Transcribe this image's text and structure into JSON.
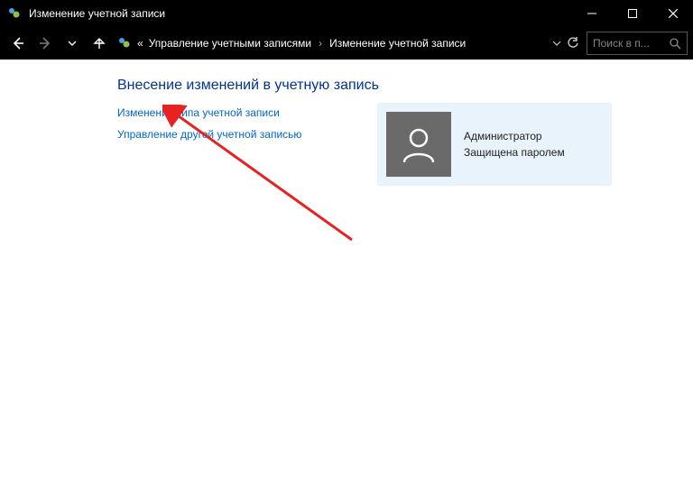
{
  "window": {
    "title": "Изменение учетной записи"
  },
  "breadcrumb": {
    "root_symbol": "«",
    "item1": "Управление учетными записями",
    "item2": "Изменение учетной записи"
  },
  "search": {
    "placeholder": "Поиск в п..."
  },
  "page": {
    "heading": "Внесение изменений в учетную запись",
    "link_change_type": "Изменение типа учетной записи",
    "link_manage_other": "Управление другой учетной записью"
  },
  "account": {
    "role": "Администратор",
    "status": "Защищена паролем"
  }
}
